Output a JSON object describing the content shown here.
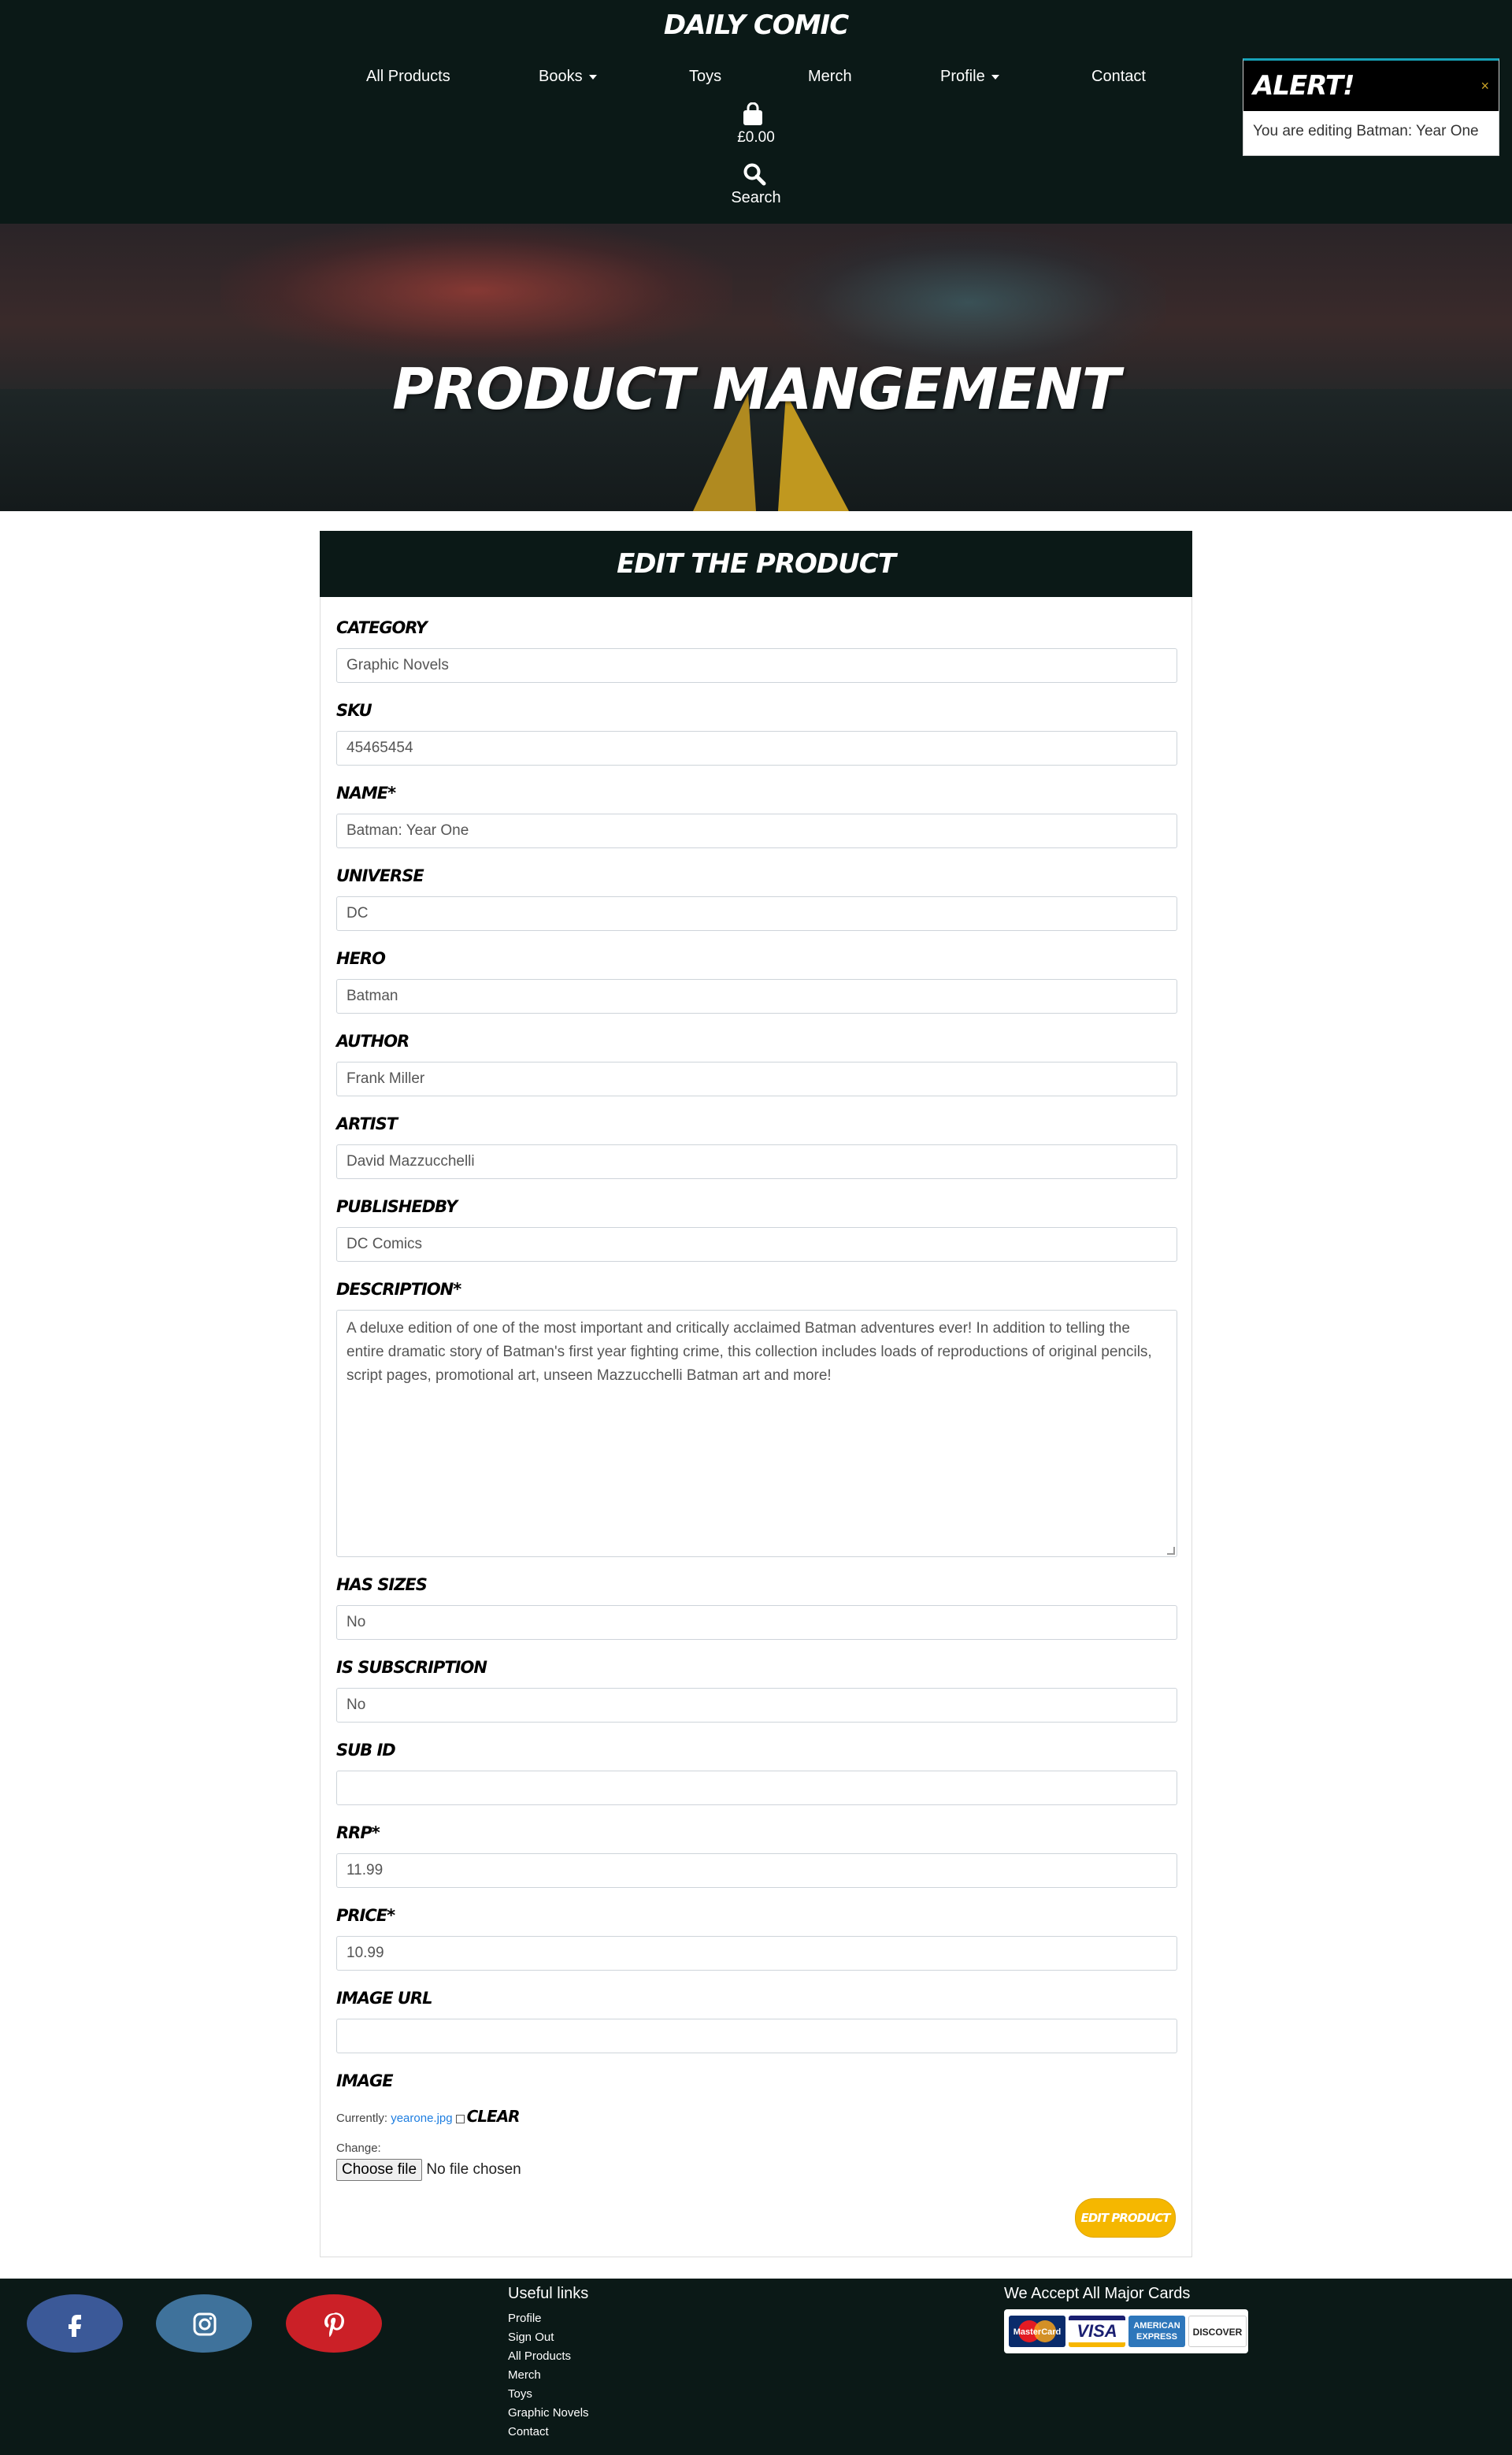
{
  "header": {
    "logo": "DAILY COMIC",
    "nav": {
      "all_products": "All Products",
      "books": "Books",
      "toys": "Toys",
      "merch": "Merch",
      "profile": "Profile",
      "contact": "Contact"
    },
    "bag_total": "£0.00",
    "search_label": "Search"
  },
  "alert": {
    "title": "ALERT!",
    "close": "×",
    "message": "You are editing Batman: Year One"
  },
  "hero": {
    "title": "PRODUCT MANGEMENT"
  },
  "form": {
    "heading": "EDIT THE PRODUCT",
    "fields": {
      "category": {
        "label": "CATEGORY",
        "value": "Graphic Novels"
      },
      "sku": {
        "label": "SKU",
        "value": "45465454"
      },
      "name": {
        "label": "NAME*",
        "value": "Batman: Year One"
      },
      "universe": {
        "label": "UNIVERSE",
        "value": "DC"
      },
      "hero": {
        "label": "HERO",
        "value": "Batman"
      },
      "author": {
        "label": "AUTHOR",
        "value": "Frank Miller"
      },
      "artist": {
        "label": "ARTIST",
        "value": "David Mazzucchelli"
      },
      "publishedby": {
        "label": "PUBLISHEDBY",
        "value": "DC Comics"
      },
      "description": {
        "label": "DESCRIPTION*",
        "value": "A deluxe edition of one of the most important and critically acclaimed Batman adventures ever! In addition to telling the entire dramatic story of Batman's first year fighting crime, this collection includes loads of reproductions of original pencils, script pages, promotional art, unseen Mazzucchelli Batman art and more!"
      },
      "has_sizes": {
        "label": "HAS SIZES",
        "value": "No"
      },
      "is_subscription": {
        "label": "IS SUBSCRIPTION",
        "value": "No"
      },
      "sub_id": {
        "label": "SUB ID",
        "value": ""
      },
      "rrp": {
        "label": "RRP*",
        "value": "11.99"
      },
      "price": {
        "label": "PRICE*",
        "value": "10.99"
      },
      "image_url": {
        "label": "IMAGE URL",
        "value": ""
      }
    },
    "image": {
      "label": "IMAGE",
      "currently_label": "Currently:",
      "current_file": "yearone.jpg",
      "clear_label": "CLEAR",
      "change_label": "Change:",
      "choose_button": "Choose file",
      "no_file": "No file chosen"
    },
    "submit": "EDIT PRODUCT"
  },
  "footer": {
    "social": [
      "facebook-icon",
      "instagram-icon",
      "pinterest-icon"
    ],
    "links_title": "Useful links",
    "links": [
      "Profile",
      "Sign Out",
      "All Products",
      "Merch",
      "Toys",
      "Graphic Novels",
      "Contact"
    ],
    "cards_title": "We Accept All Major Cards",
    "card_brands": [
      "MasterCard",
      "VISA",
      "AMERICAN EXPRESS",
      "DISCOVER"
    ]
  },
  "colors": {
    "dark_bg": "#0b1917",
    "accent_button": "#f5b700",
    "alert_border": "#17a2b8"
  }
}
